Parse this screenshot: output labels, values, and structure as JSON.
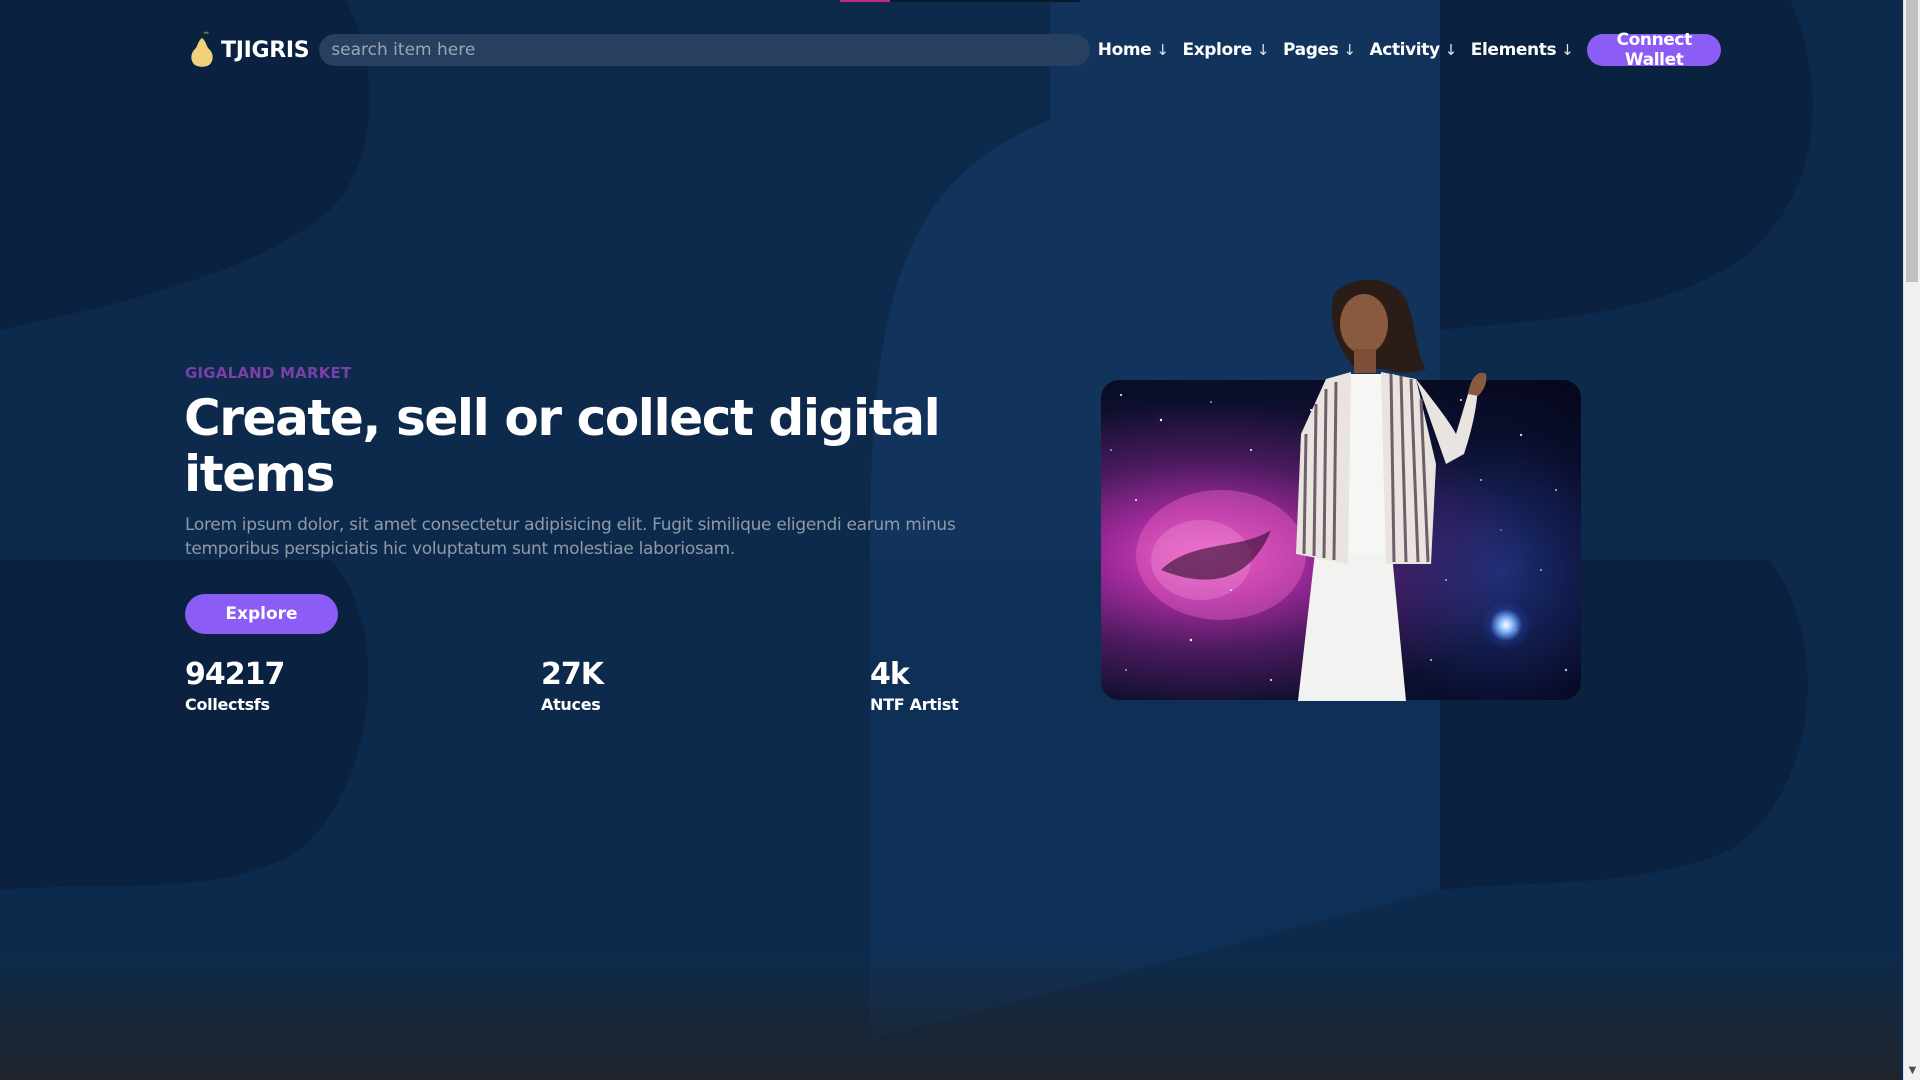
{
  "brand": {
    "name": "TJIGRIS",
    "logo_icon": "pear-icon"
  },
  "search": {
    "placeholder": "search item here"
  },
  "nav": {
    "items": [
      {
        "label": "Home",
        "arrow": "↓"
      },
      {
        "label": "Explore",
        "arrow": "↓"
      },
      {
        "label": "Pages",
        "arrow": "↓"
      },
      {
        "label": "Activity",
        "arrow": "↓"
      },
      {
        "label": "Elements",
        "arrow": "↓"
      }
    ],
    "cta": "Connect Wallet"
  },
  "hero": {
    "eyebrow": "GIGALAND MARKET",
    "title": "Create, sell or collect digital items",
    "description": "Lorem ipsum dolor, sit amet consectetur adipisicing elit. Fugit similique eligendi earum minus temporibus perspiciatis hic voluptatum sunt molestiae laboriosam.",
    "button": "Explore"
  },
  "stats": [
    {
      "value": "94217",
      "label": "Collectsfs"
    },
    {
      "value": "27K",
      "label": "Atuces"
    },
    {
      "value": "4k",
      "label": "NTF Artist"
    }
  ],
  "colors": {
    "background": "#0d2a4d",
    "accent": "#8b5cf6",
    "eyebrow": "#7b3fa8",
    "muted_text": "#8e9aa8"
  }
}
